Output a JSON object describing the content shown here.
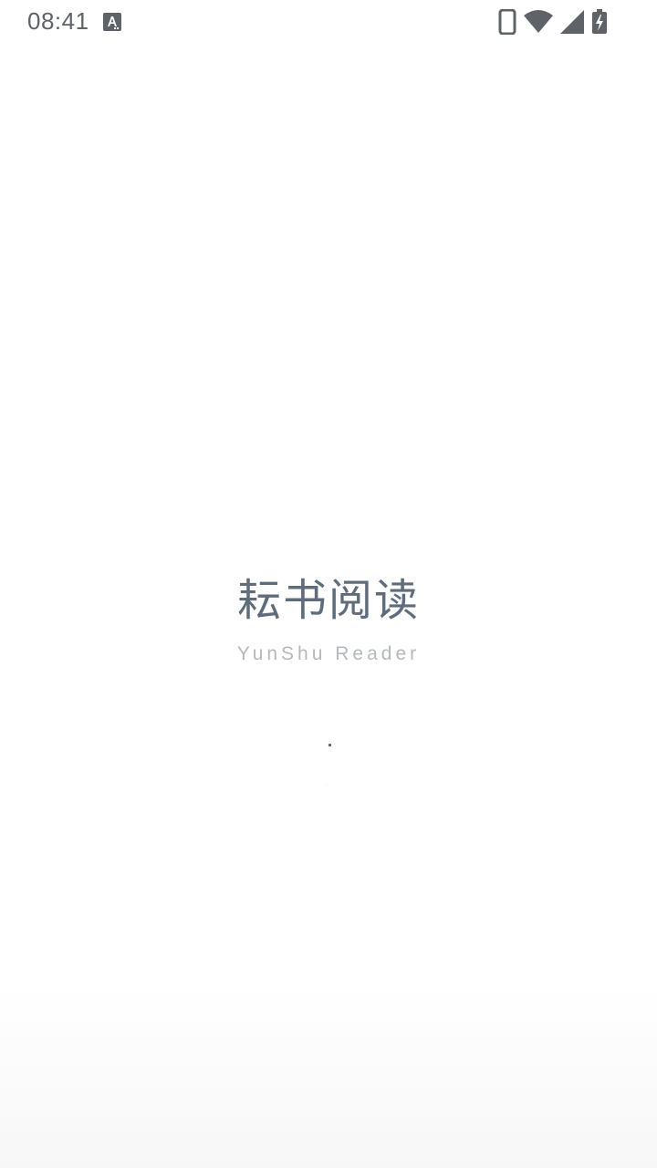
{
  "status_bar": {
    "time": "08:41",
    "icons": [
      "text-notification-icon",
      "phone-icon",
      "wifi-icon",
      "cellular-signal-icon",
      "battery-charging-icon"
    ],
    "icon_color": "#5f6368"
  },
  "splash": {
    "title": "耘书阅读",
    "subtitle": "YunShu Reader",
    "title_color": "#5f6c7b",
    "subtitle_color": "#b5b9be"
  }
}
